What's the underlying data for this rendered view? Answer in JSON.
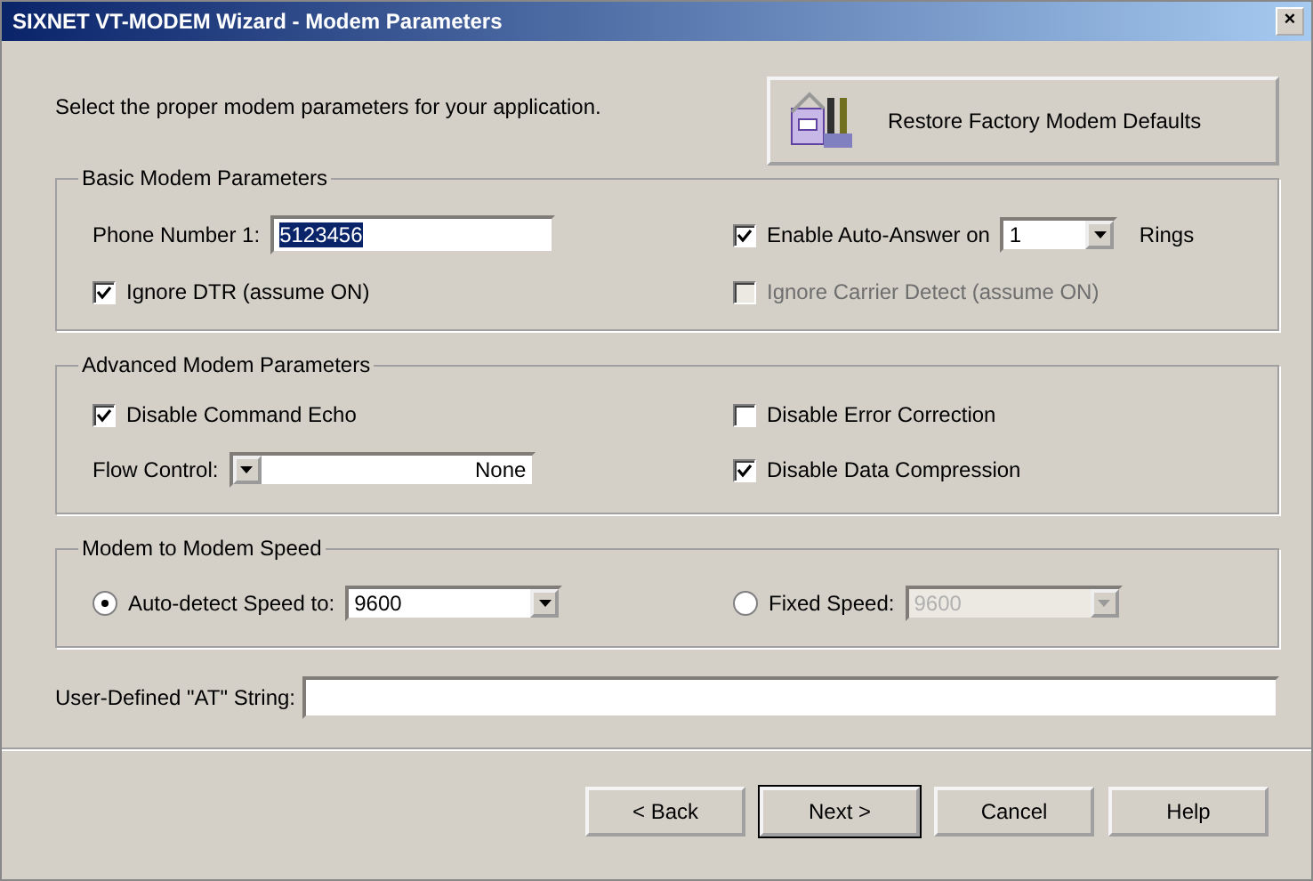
{
  "window": {
    "title": "SIXNET VT-MODEM Wizard - Modem Parameters",
    "close": "×"
  },
  "intro": "Select the proper modem parameters for your application.",
  "restore_button": "Restore Factory Modem Defaults",
  "basic": {
    "title": "Basic Modem Parameters",
    "phone": {
      "label": "Phone Number 1:",
      "value": "5123456",
      "highlighted": true
    },
    "auto_answer": {
      "label": "Enable Auto-Answer on",
      "checked": true,
      "disabled": false,
      "value": "1",
      "suffix": "Rings"
    },
    "ignore_dtr": {
      "label": "Ignore DTR (assume ON)",
      "checked": true,
      "disabled": false
    },
    "ignore_carrier": {
      "label": "Ignore Carrier Detect (assume ON)",
      "checked": false,
      "disabled": true
    }
  },
  "advanced": {
    "title": "Advanced Modem Parameters",
    "command_echo": {
      "label": "Disable Command Echo",
      "checked": true,
      "disabled": false
    },
    "flow_control": {
      "label": "Flow Control:",
      "value": "None"
    },
    "error_correction": {
      "label": "Disable Error Correction",
      "checked": false,
      "disabled": false
    },
    "data_compression": {
      "label": "Disable Data Compression",
      "checked": true,
      "disabled": false
    }
  },
  "speed": {
    "title": "Modem to Modem Speed",
    "options": [
      {
        "label": "Auto-detect Speed to:",
        "selected": true,
        "value": "9600",
        "disabled": false
      },
      {
        "label": "Fixed Speed:",
        "selected": false,
        "value": "9600",
        "disabled": true
      }
    ]
  },
  "at_string": {
    "label": "User-Defined \"AT\" String:"
  },
  "buttons": [
    {
      "label": "< Back",
      "default": false
    },
    {
      "label": "Next >",
      "default": true
    },
    {
      "label": "Cancel",
      "default": false
    },
    {
      "label": "Help",
      "default": false
    }
  ]
}
